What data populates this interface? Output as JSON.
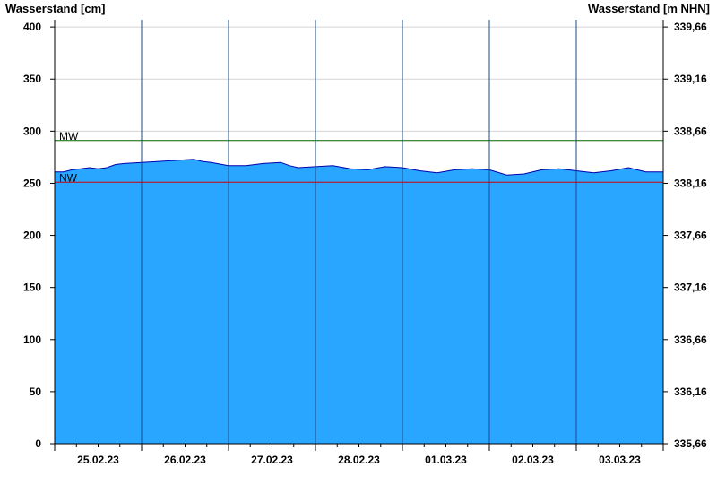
{
  "chart_data": {
    "type": "area",
    "ylabel_left": "Wasserstand [cm]",
    "ylabel_right": "Wasserstand [m NHN]",
    "ylim": [
      0,
      407
    ],
    "yticks": [
      0,
      50,
      100,
      150,
      200,
      250,
      300,
      350,
      400
    ],
    "yticks_right": [
      "335,66",
      "336,16",
      "336,66",
      "337,16",
      "337,66",
      "338,16",
      "338,66",
      "339,16",
      "339,66"
    ],
    "x_days": [
      "25.02.23",
      "26.02.23",
      "27.02.23",
      "28.02.23",
      "01.03.23",
      "02.03.23",
      "03.03.23"
    ],
    "x_range_days": [
      0,
      7
    ],
    "grid": true,
    "fill_color": "#29a6ff",
    "line_color": "#0000aa",
    "reference_lines": [
      {
        "name": "MW",
        "value": 291,
        "color": "#006400"
      },
      {
        "name": "NW",
        "value": 251,
        "color": "#cc0000"
      }
    ],
    "series": [
      {
        "x": [
          0.0,
          0.1,
          0.2,
          0.3,
          0.4,
          0.5,
          0.6,
          0.7,
          0.8,
          1.0,
          1.2,
          1.4,
          1.6,
          1.7,
          1.8,
          2.0,
          2.2,
          2.4,
          2.6,
          2.7,
          2.8,
          3.0,
          3.2,
          3.4,
          3.6,
          3.8,
          4.0,
          4.2,
          4.4,
          4.6,
          4.8,
          5.0,
          5.2,
          5.4,
          5.6,
          5.8,
          6.0,
          6.2,
          6.4,
          6.6,
          6.8,
          7.0
        ],
        "values": [
          261,
          261,
          263,
          264,
          265,
          264,
          265,
          268,
          269,
          270,
          271,
          272,
          273,
          271,
          270,
          267,
          267,
          269,
          270,
          267,
          265,
          266,
          267,
          264,
          263,
          266,
          265,
          262,
          260,
          263,
          264,
          263,
          258,
          259,
          263,
          264,
          262,
          260,
          262,
          265,
          261,
          261
        ]
      }
    ]
  }
}
